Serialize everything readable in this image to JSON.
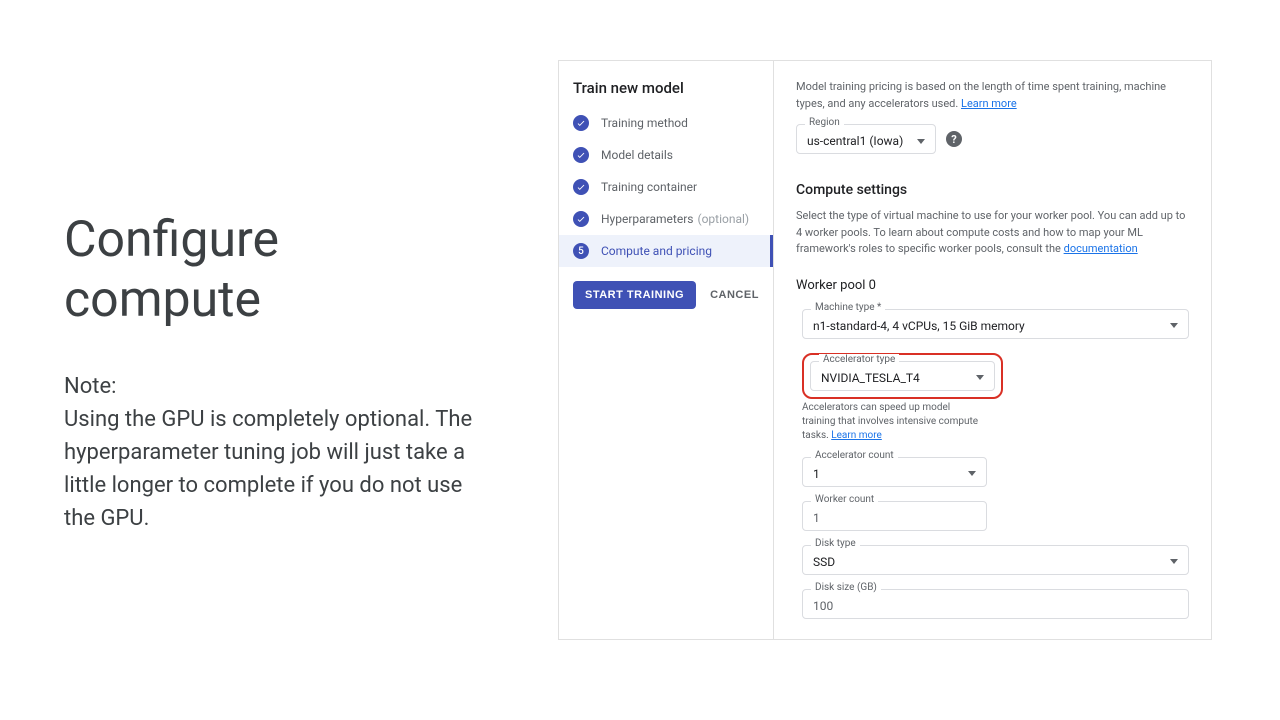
{
  "slide": {
    "title_line1": "Configure",
    "title_line2": "compute",
    "note_label": "Note:",
    "note_body": "Using the GPU is completely optional. The hyperparameter tuning job will just take a little longer to complete if you do not use the GPU."
  },
  "sidebar": {
    "title": "Train new model",
    "steps": [
      {
        "label": "Training method"
      },
      {
        "label": "Model details"
      },
      {
        "label": "Training container"
      },
      {
        "label": "Hyperparameters",
        "optional": "(optional)"
      },
      {
        "label": "Compute and pricing"
      }
    ],
    "start_training": "START TRAINING",
    "cancel": "CANCEL"
  },
  "main": {
    "pricing_text": "Model training pricing is based on the length of time spent training, machine types, and any accelerators used. ",
    "learn_more": "Learn more",
    "region": {
      "label": "Region",
      "value": "us-central1 (Iowa)"
    },
    "compute_title": "Compute settings",
    "compute_desc": "Select the type of virtual machine to use for your worker pool. You can add up to 4 worker pools. To learn about compute costs and how to map your ML framework's roles to specific worker pools, consult the ",
    "documentation": "documentation",
    "pool_title": "Worker pool 0",
    "machine_type": {
      "label": "Machine type *",
      "value": "n1-standard-4, 4 vCPUs, 15 GiB memory"
    },
    "accel_type": {
      "label": "Accelerator type",
      "value": "NVIDIA_TESLA_T4"
    },
    "accel_help": "Accelerators can speed up model training that involves intensive compute tasks. ",
    "accel_count": {
      "label": "Accelerator count",
      "value": "1"
    },
    "worker_count": {
      "label": "Worker count",
      "value": "1"
    },
    "disk_type": {
      "label": "Disk type",
      "value": "SSD"
    },
    "disk_size": {
      "label": "Disk size (GB)",
      "value": "100"
    }
  }
}
